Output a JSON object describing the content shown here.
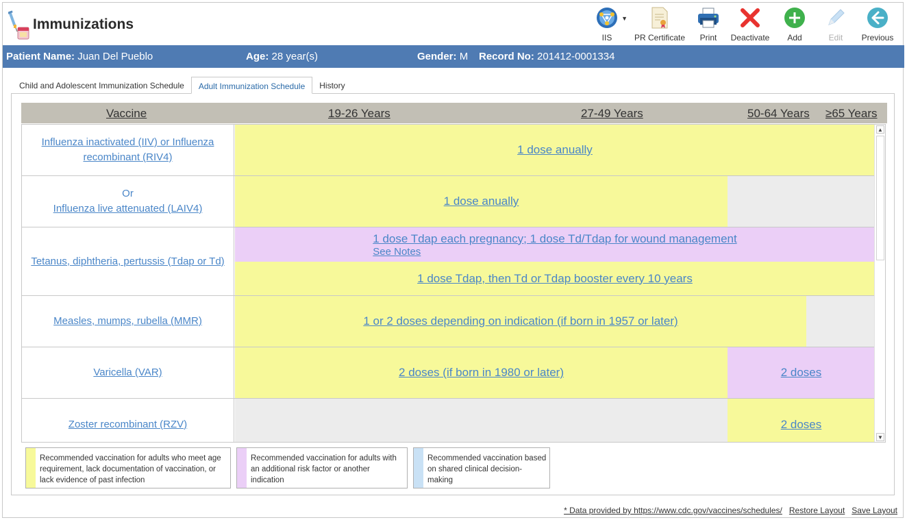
{
  "app": {
    "title": "Immunizations",
    "icon": "syringe-vial-icon"
  },
  "toolbar": {
    "iis": "IIS",
    "pr_certificate": "PR Certificate",
    "print": "Print",
    "deactivate": "Deactivate",
    "add": "Add",
    "edit": "Edit",
    "previous": "Previous"
  },
  "patient": {
    "name_label": "Patient Name:",
    "name": "Juan Del Pueblo",
    "age_label": "Age:",
    "age": "28 year(s)",
    "gender_label": "Gender:",
    "gender": "M",
    "record_label": "Record No:",
    "record": "201412-0001334"
  },
  "tabs": [
    {
      "label": "Child and Adolescent Immunization Schedule",
      "active": false
    },
    {
      "label": "Adult Immunization Schedule",
      "active": true
    },
    {
      "label": "History",
      "active": false
    }
  ],
  "schedule": {
    "headers": {
      "vaccine": "Vaccine",
      "a": "19-26 Years",
      "b": "27-49 Years",
      "c": "50-64 Years",
      "d": "≥65 Years"
    },
    "rows": [
      {
        "vaccine": "Influenza inactivated (IIV) or Influenza recombinant (RIV4)",
        "band1": "1 dose anually"
      },
      {
        "or": "Or",
        "vaccine": "Influenza live attenuated (LAIV4)",
        "band1": "1 dose anually"
      },
      {
        "vaccine": "Tetanus, diphtheria, pertussis (Tdap or Td)",
        "band1": "1 dose Tdap each pregnancy; 1 dose Td/Tdap for wound management",
        "notes": "See Notes",
        "band2": "1 dose Tdap, then Td or Tdap booster every 10 years"
      },
      {
        "vaccine": "Measles, mumps, rubella (MMR)",
        "band1": "1 or 2 doses depending on indication (if born in 1957 or later)"
      },
      {
        "vaccine": "Varicella (VAR)",
        "band1": "2 doses (if born in 1980 or later)",
        "band2": "2 doses"
      },
      {
        "vaccine": "Zoster recombinant (RZV)",
        "band1": "2 doses"
      }
    ]
  },
  "legend": [
    {
      "color": "#f7f99a",
      "text": "Recommended vaccination for adults who meet age requirement, lack documentation of vaccination, or lack evidence of past infection"
    },
    {
      "color": "#ebcff7",
      "text": "Recommended vaccination for adults with an additional risk factor or another indication"
    },
    {
      "color": "#c9e1f5",
      "text": "Recommended vaccination based on shared clinical decision-making"
    }
  ],
  "footer": {
    "source": "* Data provided by https://www.cdc.gov/vaccines/schedules/",
    "restore": "Restore Layout",
    "save": "Save Layout"
  },
  "colors": {
    "patient_bar": "#4f7bb3",
    "link": "#4a86c8",
    "yellow": "#f7f99a",
    "purple": "#ebcff7",
    "grey": "#ececec"
  }
}
